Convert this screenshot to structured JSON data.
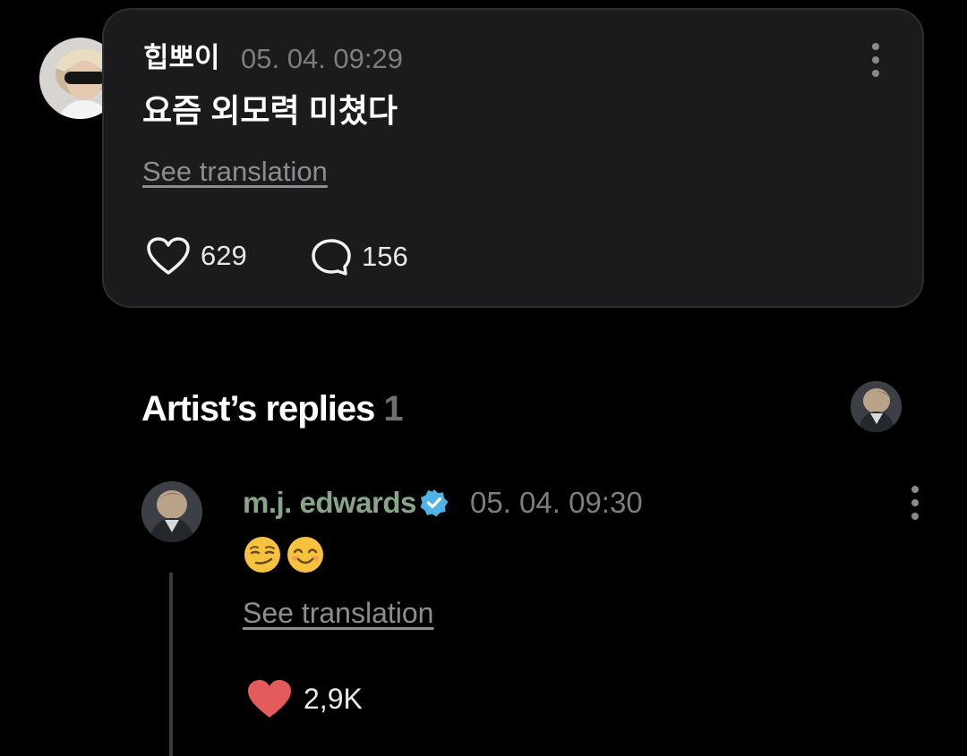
{
  "post": {
    "author": "힙뽀이",
    "timestamp": "05. 04. 09:29",
    "text": "요즘 외모력 미쳤다",
    "translate_label": "See translation",
    "likes": "629",
    "comments": "156"
  },
  "artist_replies": {
    "title": "Artist’s replies",
    "count": "1"
  },
  "reply": {
    "author": "m.j. edwards",
    "verified": true,
    "timestamp": "05. 04. 09:30",
    "emojis": [
      "smirking-face",
      "smiling-face-with-smiling-eyes"
    ],
    "translate_label": "See translation",
    "likes": "2,9K"
  },
  "colors": {
    "background": "#000000",
    "card": "#1b1b1d",
    "artist_name": "#88a588",
    "liked_heart": "#e35b5b",
    "verified_badge": "#4eb4e6"
  }
}
